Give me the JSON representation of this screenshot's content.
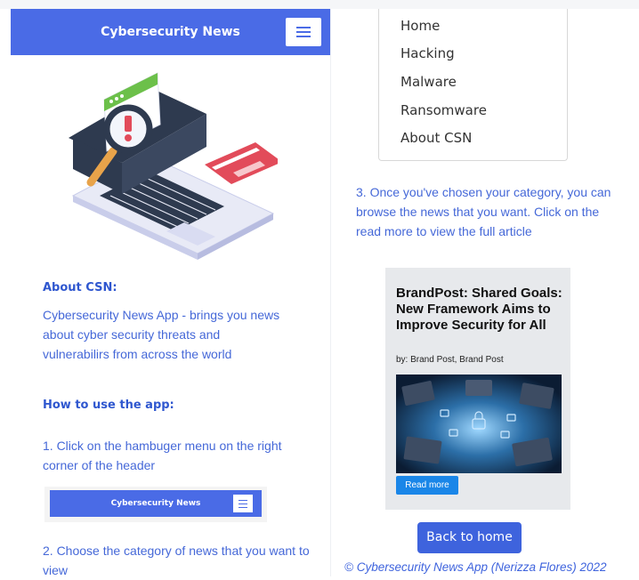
{
  "header": {
    "title": "Cybersecurity News"
  },
  "about": {
    "heading": "About CSN:",
    "text": "Cybersecurity News App - brings you news about cyber security threats and vulnerabilirs from across the world"
  },
  "howto": {
    "heading": "How to use the app:",
    "step1": "1. Click on the hambuger menu on the right corner of the header",
    "mini_header_title": "Cybersecurity News",
    "step2": "2. Choose the category of news that you want to view",
    "step3": "3. Once you've chosen your category, you can browse the news that you want. Click on the read more to view the full article"
  },
  "menu": {
    "items": [
      "Home",
      "Hacking",
      "Malware",
      "Ransomware",
      "About CSN"
    ]
  },
  "card": {
    "title": "BrandPost: Shared Goals: New Framework Aims to Improve Security for All",
    "byline": "by: Brand Post, Brand Post",
    "read_more": "Read more"
  },
  "back_button": "Back to home",
  "footer": "© Cybersecurity News App (Nerizza Flores) 2022",
  "colors": {
    "primary": "#4a6be6",
    "text_blue": "#4568d8",
    "read_more": "#1a86e8"
  },
  "icons": {
    "menu": "hamburger-icon"
  }
}
